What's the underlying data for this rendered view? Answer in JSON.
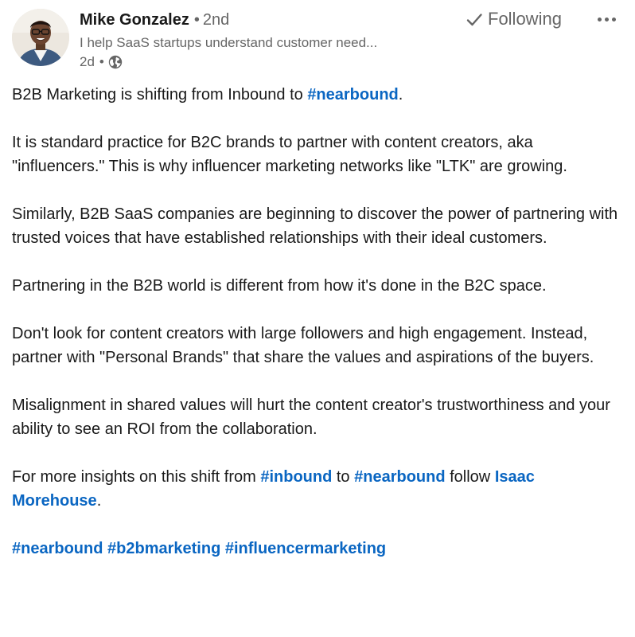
{
  "author": {
    "name": "Mike Gonzalez",
    "separator": "•",
    "degree": "2nd",
    "headline": "I help SaaS startups understand customer need...",
    "time": "2d",
    "time_separator": "•",
    "visibility_icon": "globe-icon",
    "avatar_icon": "profile-photo"
  },
  "actions": {
    "following_label": "Following",
    "following_icon": "check-icon",
    "more_icon": "ellipsis-icon"
  },
  "post": {
    "p1": {
      "t1": "B2B Marketing is shifting from Inbound to ",
      "h1": "#nearbound",
      "t2": "."
    },
    "p2": "It is standard practice for B2C brands to partner with content creators, aka \"influencers.\" This is why influencer marketing networks like \"LTK\" are growing.",
    "p3": "Similarly, B2B SaaS companies are beginning to discover the power of partnering with trusted voices that have established relationships with their ideal customers.",
    "p4": "Partnering in the B2B world is different from how it's done in the B2C space.",
    "p5": "Don't look for content creators with large followers and high engagement. Instead, partner with \"Personal Brands\" that share the values and aspirations of the buyers.",
    "p6": "Misalignment in shared values will hurt the content creator's trustworthiness and your ability to see an ROI from the collaboration.",
    "p7": {
      "t1": "For more insights on this shift from ",
      "h1": "#inbound",
      "t2": " to ",
      "h2": "#nearbound",
      "t3": " follow ",
      "mention": "Isaac Morehouse",
      "t4": "."
    },
    "hashtags": [
      "#nearbound",
      "#b2bmarketing",
      "#influencermarketing"
    ]
  },
  "colors": {
    "link": "#0a66c2",
    "muted": "#666666",
    "text": "rgba(0,0,0,0.9)"
  }
}
